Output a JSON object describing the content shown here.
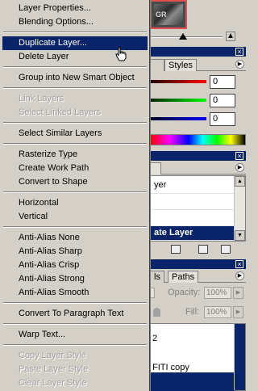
{
  "menu": {
    "items": [
      {
        "label": "Layer Properties...",
        "enabled": true
      },
      {
        "label": "Blending Options...",
        "enabled": true
      },
      {
        "label": "Duplicate Layer...",
        "enabled": true,
        "highlighted": true
      },
      {
        "label": "Delete Layer",
        "enabled": true
      },
      {
        "label": "Group into New Smart Object",
        "enabled": true
      },
      {
        "label": "Link Layers",
        "enabled": false
      },
      {
        "label": "Select Linked Layers",
        "enabled": false
      },
      {
        "label": "Select Similar Layers",
        "enabled": true
      },
      {
        "label": "Rasterize Type",
        "enabled": true
      },
      {
        "label": "Create Work Path",
        "enabled": true
      },
      {
        "label": "Convert to Shape",
        "enabled": true
      },
      {
        "label": "Horizontal",
        "enabled": true
      },
      {
        "label": "Vertical",
        "enabled": true
      },
      {
        "label": "Anti-Alias None",
        "enabled": true
      },
      {
        "label": "Anti-Alias Sharp",
        "enabled": true
      },
      {
        "label": "Anti-Alias Crisp",
        "enabled": true
      },
      {
        "label": "Anti-Alias Strong",
        "enabled": true
      },
      {
        "label": "Anti-Alias Smooth",
        "enabled": true
      },
      {
        "label": "Convert To Paragraph Text",
        "enabled": true
      },
      {
        "label": "Warp Text...",
        "enabled": true
      },
      {
        "label": "Copy Layer Style",
        "enabled": false
      },
      {
        "label": "Paste Layer Style",
        "enabled": false
      },
      {
        "label": "Clear Layer Style",
        "enabled": false
      }
    ]
  },
  "color_panel": {
    "tab_styles": "Styles",
    "values": [
      "0",
      "0",
      "0"
    ],
    "colors": [
      "#c00000",
      "#00a000",
      "#0000c0"
    ]
  },
  "actions_panel": {
    "row_partial": "yer",
    "selected_partial": "ate Layer"
  },
  "layers_panel": {
    "tab_paths_partial": "ls",
    "tab_paths": "Paths",
    "opacity_label": "Opacity:",
    "opacity_value": "100%",
    "fill_label": "Fill:",
    "fill_value": "100%",
    "layer_partial_1": "2",
    "layer_partial_2": "FITI copy"
  },
  "accent_color": "#0a246a"
}
